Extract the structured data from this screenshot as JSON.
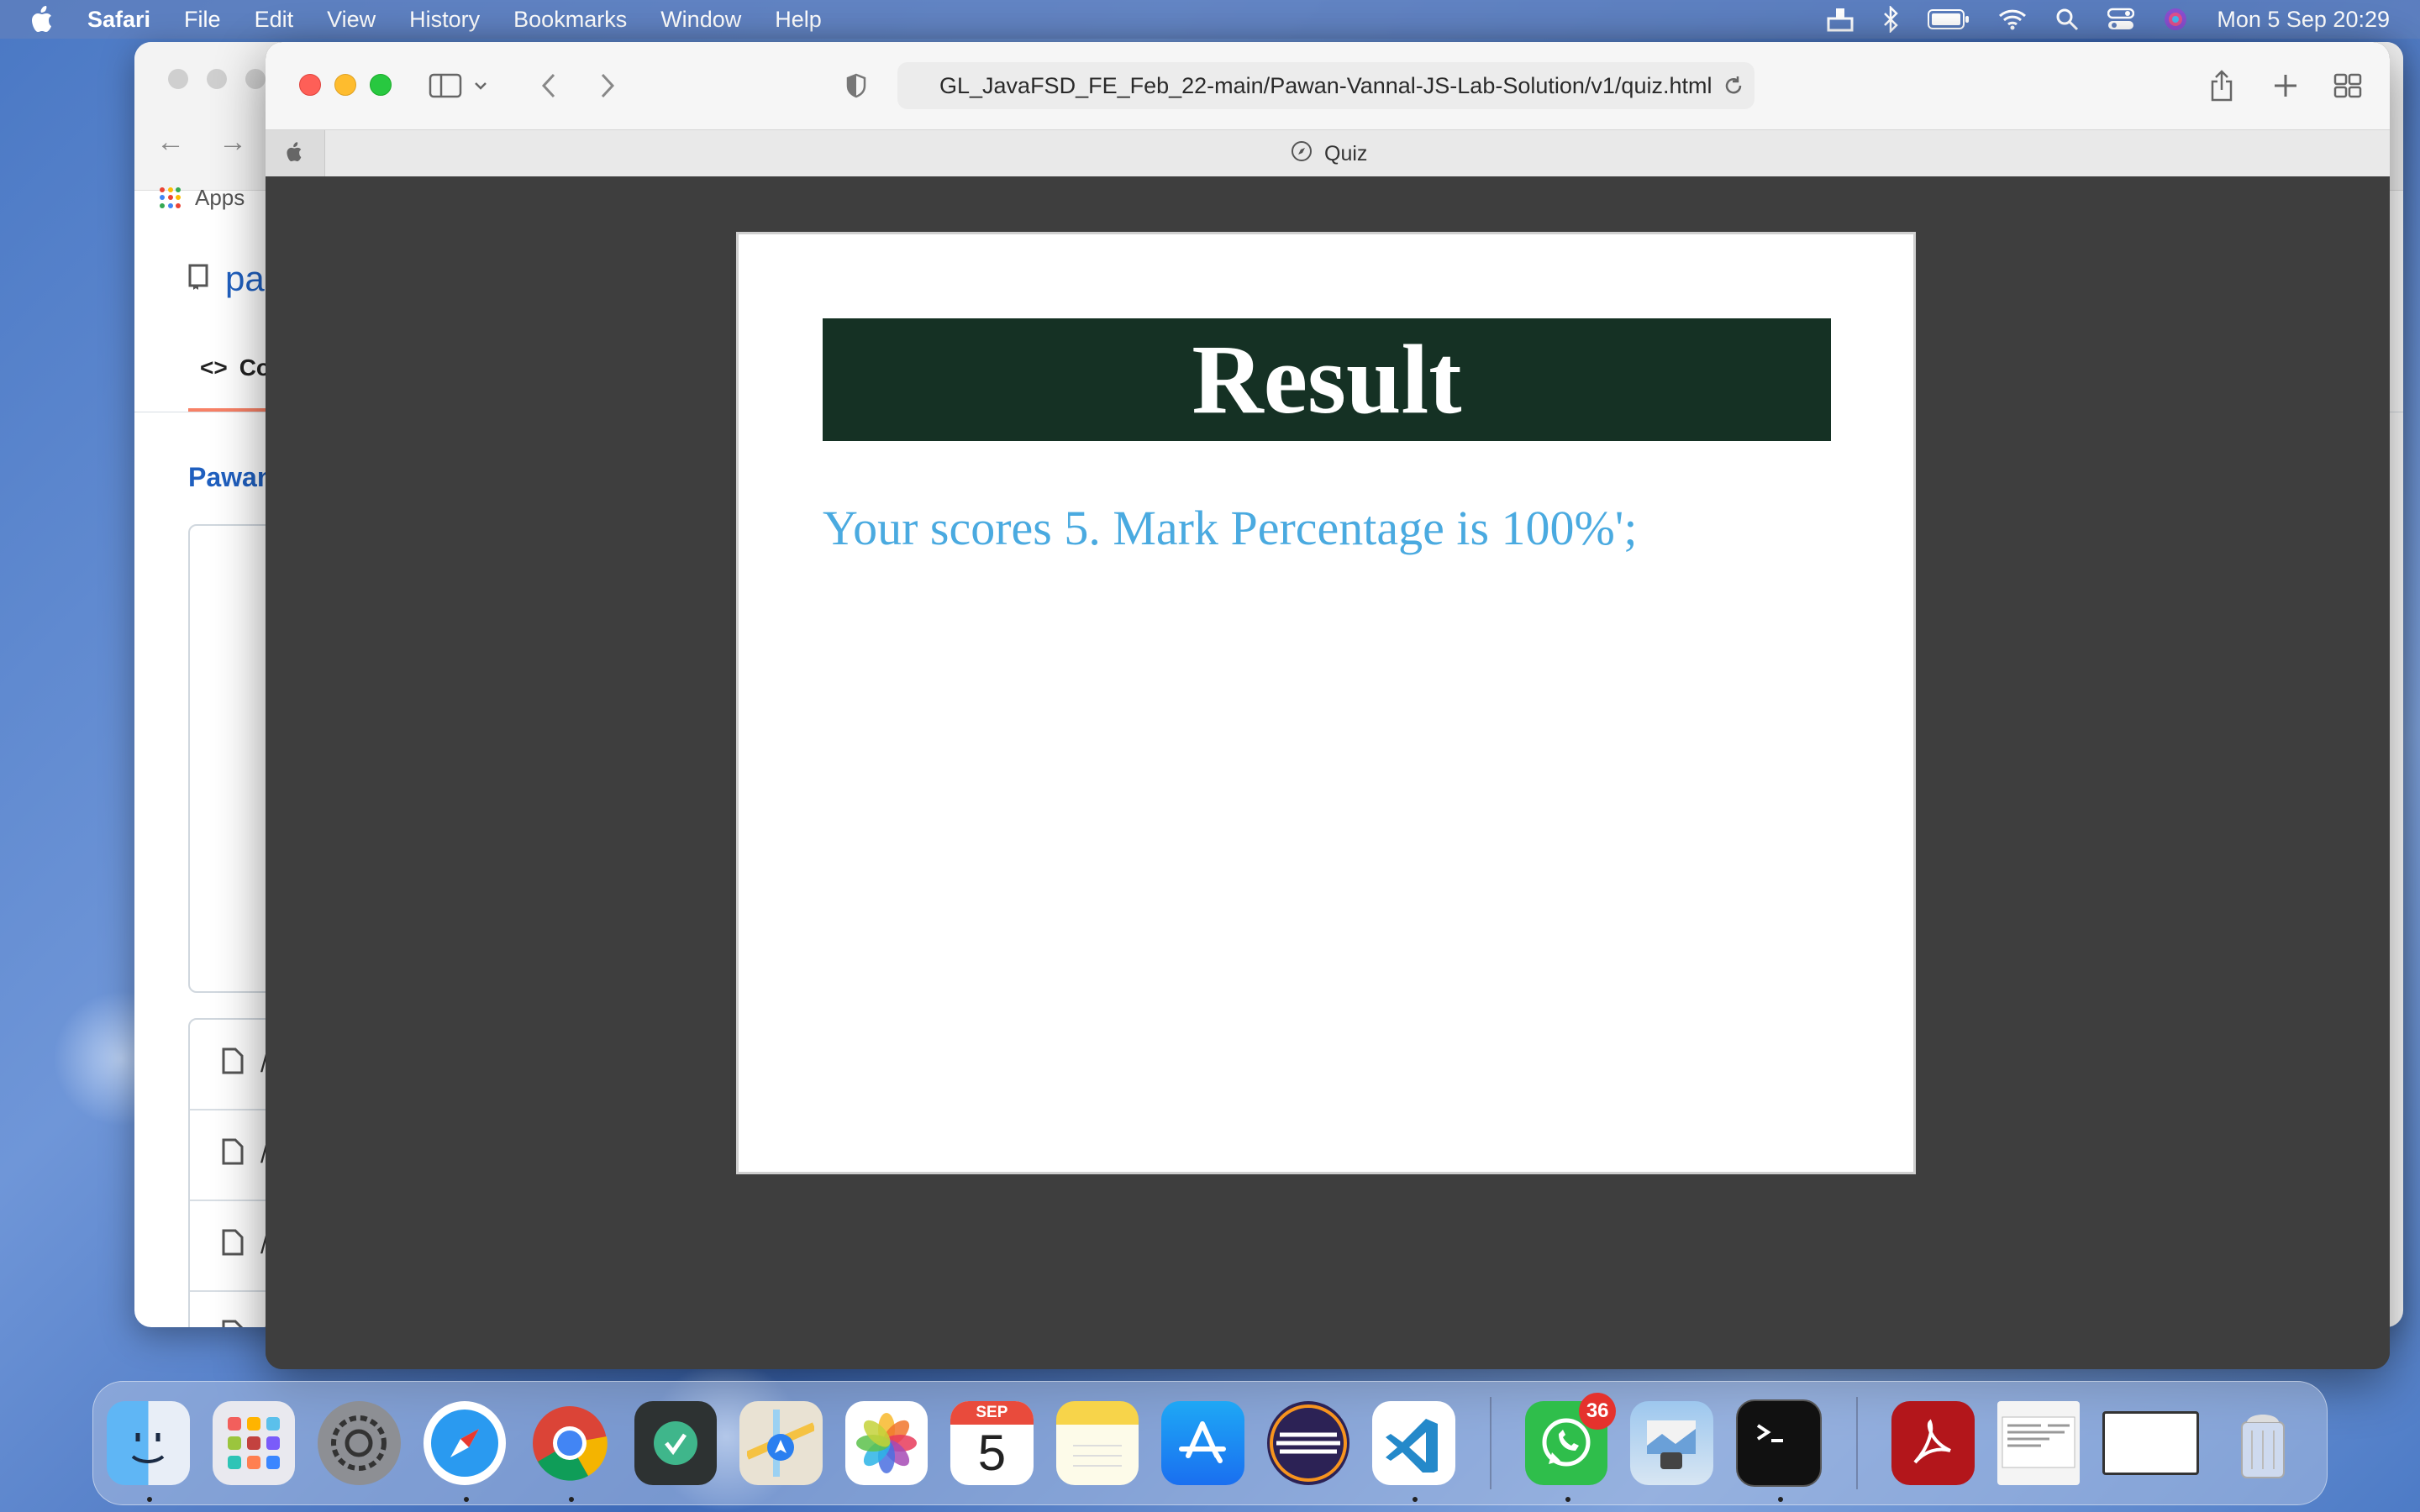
{
  "menubar": {
    "app_name": "Safari",
    "items": [
      "File",
      "Edit",
      "View",
      "History",
      "Bookmarks",
      "Window",
      "Help"
    ],
    "clock": "Mon 5 Sep  20:29"
  },
  "background_window": {
    "apps_label": "Apps",
    "repo_text": "pa",
    "code_tab": "Co",
    "author": "Pawan",
    "file_rows": [
      "/",
      "/",
      "/",
      "/"
    ]
  },
  "browser": {
    "url": "GL_JavaFSD_FE_Feb_22-main/Pawan-Vannal-JS-Lab-Solution/v1/quiz.html",
    "tab_title": "Quiz"
  },
  "page": {
    "heading": "Result",
    "score_text": "Your scores 5. Mark Percentage is 100%';"
  },
  "dock": {
    "calendar_month": "SEP",
    "calendar_day": "5",
    "whatsapp_badge": "36",
    "apps": [
      "finder-icon",
      "launchpad-icon",
      "system-preferences-icon",
      "safari-icon",
      "chrome-icon",
      "vpn-app-icon",
      "maps-icon",
      "photos-icon",
      "calendar-icon",
      "notes-icon",
      "app-store-icon",
      "eclipse-icon",
      "vscode-icon",
      "whatsapp-icon",
      "preview-icon",
      "terminal-icon",
      "acrobat-icon",
      "document-thumbnail-icon",
      "window-thumbnail-icon",
      "trash-icon"
    ]
  },
  "colors": {
    "banner_bg": "#153124",
    "score_text": "#4aaae0",
    "page_bg": "#3e3e3e"
  }
}
